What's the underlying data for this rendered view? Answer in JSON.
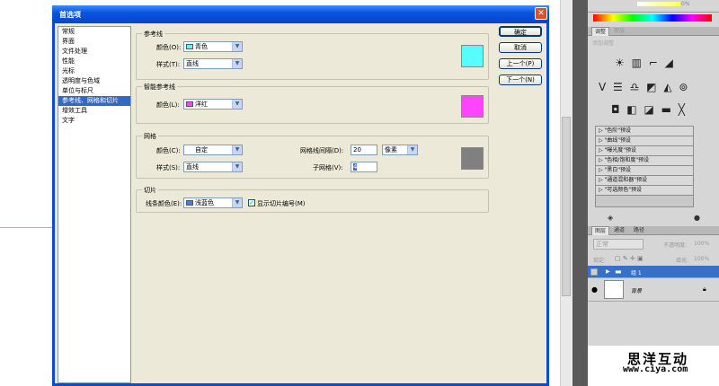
{
  "dialog": {
    "title": "首选项",
    "close_symbol": "✕",
    "categories": [
      "常规",
      "界面",
      "文件处理",
      "性能",
      "光标",
      "透明度与色域",
      "单位与标尺",
      "参考线、网格和切片",
      "增效工具",
      "文字"
    ],
    "selected_category": 7,
    "buttons": {
      "ok": "确定",
      "cancel": "取消",
      "prev": "上一个(P)",
      "next": "下一个(N)"
    },
    "guides": {
      "title": "参考线",
      "color_label": "颜色(O):",
      "color_value": "青色",
      "color_hex": "#55ffff",
      "style_label": "样式(T):",
      "style_value": "直线"
    },
    "smart_guides": {
      "title": "智能参考线",
      "color_label": "颜色(L):",
      "color_value": "洋红",
      "color_hex": "#ff44ff"
    },
    "grid": {
      "title": "网格",
      "color_label": "颜色(C):",
      "color_value": "自定",
      "style_label": "样式(S):",
      "style_value": "直线",
      "gridline_label": "网格线间隔(D):",
      "gridline_value": "20",
      "unit_value": "像素",
      "subdiv_label": "子网格(V):",
      "subdiv_value": "4",
      "preview_hex": "#808080"
    },
    "slices": {
      "title": "切片",
      "line_color_label": "线条颜色(E):",
      "line_color_value": "浅蓝色",
      "line_color_hex": "#4a7ed8",
      "show_numbers_label": "显示切片编号(M)",
      "show_numbers_checked": true
    }
  },
  "photoshop": {
    "slider_value": "0%",
    "adjust_tabs": [
      "调整",
      "蒙版"
    ],
    "adjust_hint": "添加调整",
    "adjust_icons_row1": "☀ ▥ ⌐ ◢",
    "adjust_icons_row2": "V ☰ ♎ ◩ ◭ ⊚",
    "adjust_icons_row3": "◘ ◧ ◪ ▬ ╳",
    "presets": [
      "\"色阶\"预设",
      "\"曲线\"预设",
      "\"曝光度\"预设",
      "\"色相/饱和度\"预设",
      "\"黑白\"预设",
      "\"通道混和器\"预设",
      "\"可选颜色\"预设"
    ],
    "layer_tabs": [
      "图层",
      "通道",
      "路径"
    ],
    "blend_mode": "正常",
    "opacity_label": "不透明度:",
    "opacity_value": "100%",
    "lock_label": "锁定:",
    "fill_label": "填充:",
    "fill_value": "100%",
    "layers": [
      {
        "name": "组 1",
        "selected": true,
        "visible": false
      },
      {
        "name": "背景",
        "selected": false,
        "visible": true
      }
    ]
  },
  "watermark": {
    "title": "思洋互动",
    "url": "www.ciya.com"
  }
}
